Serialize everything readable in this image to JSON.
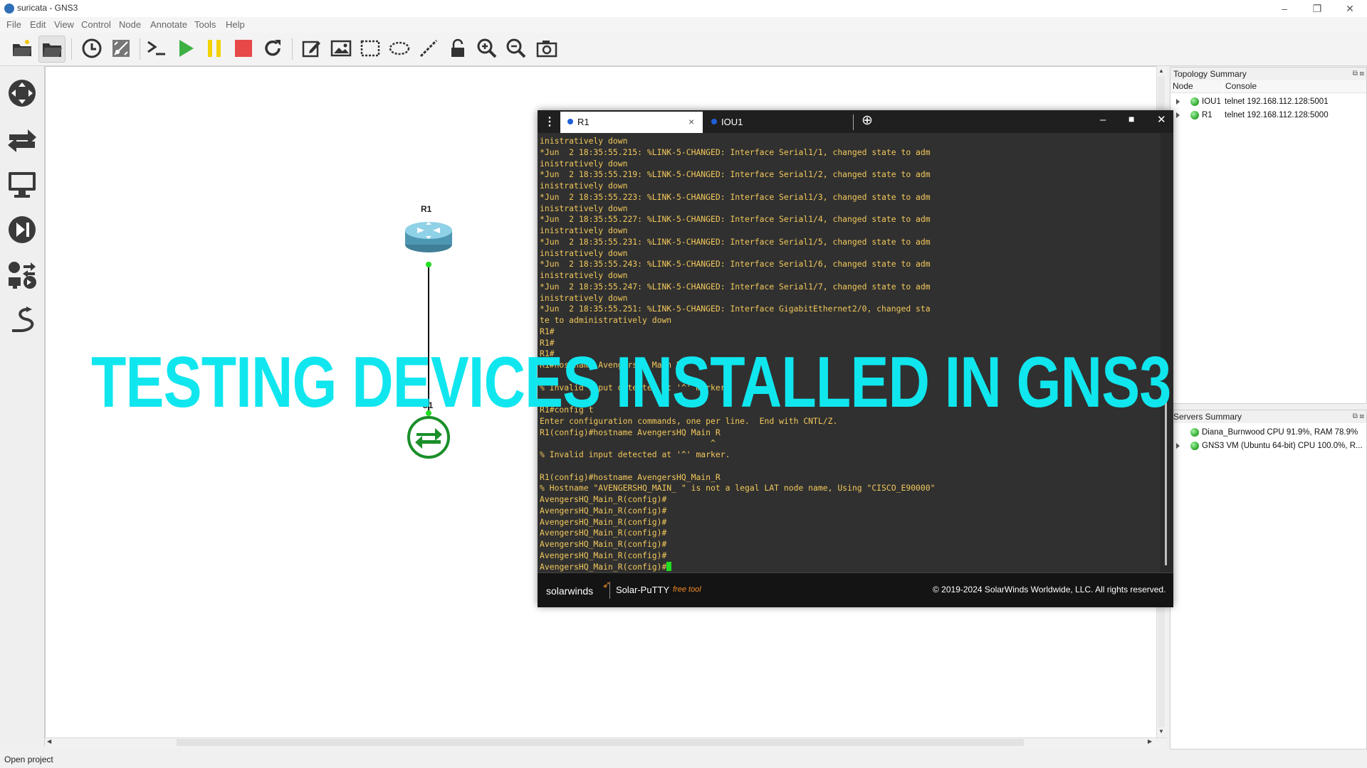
{
  "window": {
    "title": "suricata - GNS3",
    "minimize": "–",
    "maximize": "❐",
    "close": "✕"
  },
  "menu": [
    "File",
    "Edit",
    "View",
    "Control",
    "Node",
    "Annotate",
    "Tools",
    "Help"
  ],
  "toolbar_icons": [
    "new-project-icon",
    "open-project-icon",
    "snapshot-icon",
    "show-interfaces-icon",
    "console-all-icon",
    "start-all-icon",
    "pause-all-icon",
    "stop-all-icon",
    "reload-all-icon",
    "add-note-icon",
    "insert-image-icon",
    "draw-rectangle-icon",
    "draw-ellipse-icon",
    "draw-line-icon",
    "lock-icon",
    "zoom-in-icon",
    "zoom-out-icon",
    "screenshot-icon"
  ],
  "left_dock_icons": [
    "routers-icon",
    "switches-icon",
    "end-devices-icon",
    "security-devices-icon",
    "all-devices-icon",
    "add-link-icon"
  ],
  "canvas": {
    "nodes": [
      {
        "name": "R1",
        "type": "router"
      },
      {
        "name": "U1",
        "type": "switch"
      }
    ],
    "link_status_color": "#22dd22"
  },
  "topology_summary": {
    "title": "Topology Summary",
    "columns": [
      "Node",
      "Console"
    ],
    "rows": [
      {
        "node": "IOU1",
        "console": "telnet 192.168.112.128:5001"
      },
      {
        "node": "R1",
        "console": "telnet 192.168.112.128:5000"
      }
    ]
  },
  "servers_summary": {
    "title": "Servers Summary",
    "rows": [
      {
        "text": "Diana_Burnwood CPU 91.9%, RAM 78.9%"
      },
      {
        "text": "GNS3 VM (Ubuntu 64-bit) CPU 100.0%, R..."
      }
    ]
  },
  "putty": {
    "tabs": [
      {
        "label": "R1",
        "close": "×"
      },
      {
        "label": "IOU1"
      }
    ],
    "add_tab": "⊕",
    "terminal_lines": [
      "inistratively down",
      "*Jun  2 18:35:55.215: %LINK-5-CHANGED: Interface Serial1/1, changed state to adm",
      "inistratively down",
      "*Jun  2 18:35:55.219: %LINK-5-CHANGED: Interface Serial1/2, changed state to adm",
      "inistratively down",
      "*Jun  2 18:35:55.223: %LINK-5-CHANGED: Interface Serial1/3, changed state to adm",
      "inistratively down",
      "*Jun  2 18:35:55.227: %LINK-5-CHANGED: Interface Serial1/4, changed state to adm",
      "inistratively down",
      "*Jun  2 18:35:55.231: %LINK-5-CHANGED: Interface Serial1/5, changed state to adm",
      "inistratively down",
      "*Jun  2 18:35:55.243: %LINK-5-CHANGED: Interface Serial1/6, changed state to adm",
      "inistratively down",
      "*Jun  2 18:35:55.247: %LINK-5-CHANGED: Interface Serial1/7, changed state to adm",
      "inistratively down",
      "*Jun  2 18:35:55.251: %LINK-5-CHANGED: Interface GigabitEthernet2/0, changed sta",
      "te to administratively down",
      "R1#",
      "R1#",
      "R1#",
      "R1#hostname AvengersHQ Main R",
      "",
      "% Invalid input detected at '^' marker.",
      "",
      "R1#config t",
      "Enter configuration commands, one per line.  End with CNTL/Z.",
      "R1(config)#hostname AvengersHQ Main R",
      "                                   ^",
      "% Invalid input detected at '^' marker.",
      "",
      "R1(config)#hostname AvengersHQ_Main_R",
      "% Hostname \"AVENGERSHQ_MAIN_ \" is not a legal LAT node name, Using \"CISCO_E90000\"",
      "AvengersHQ_Main_R(config)#",
      "AvengersHQ_Main_R(config)#",
      "AvengersHQ_Main_R(config)#",
      "AvengersHQ_Main_R(config)#",
      "AvengersHQ_Main_R(config)#",
      "AvengersHQ_Main_R(config)#",
      "AvengersHQ_Main_R(config)#"
    ],
    "footer": {
      "brand": "solarwinds",
      "product": "Solar-PuTTY",
      "tag": "free tool",
      "copyright": "© 2019-2024 SolarWinds Worldwide, LLC. All rights reserved."
    }
  },
  "overlay_banner": "TESTING DEVICES INSTALLED IN GNS3",
  "status_bar": "Open project",
  "colors": {
    "banner": "#10e6ee",
    "terminal_text": "#f2c85b",
    "cursor": "#22dd22",
    "tab_dot": "#1e5fd6"
  }
}
